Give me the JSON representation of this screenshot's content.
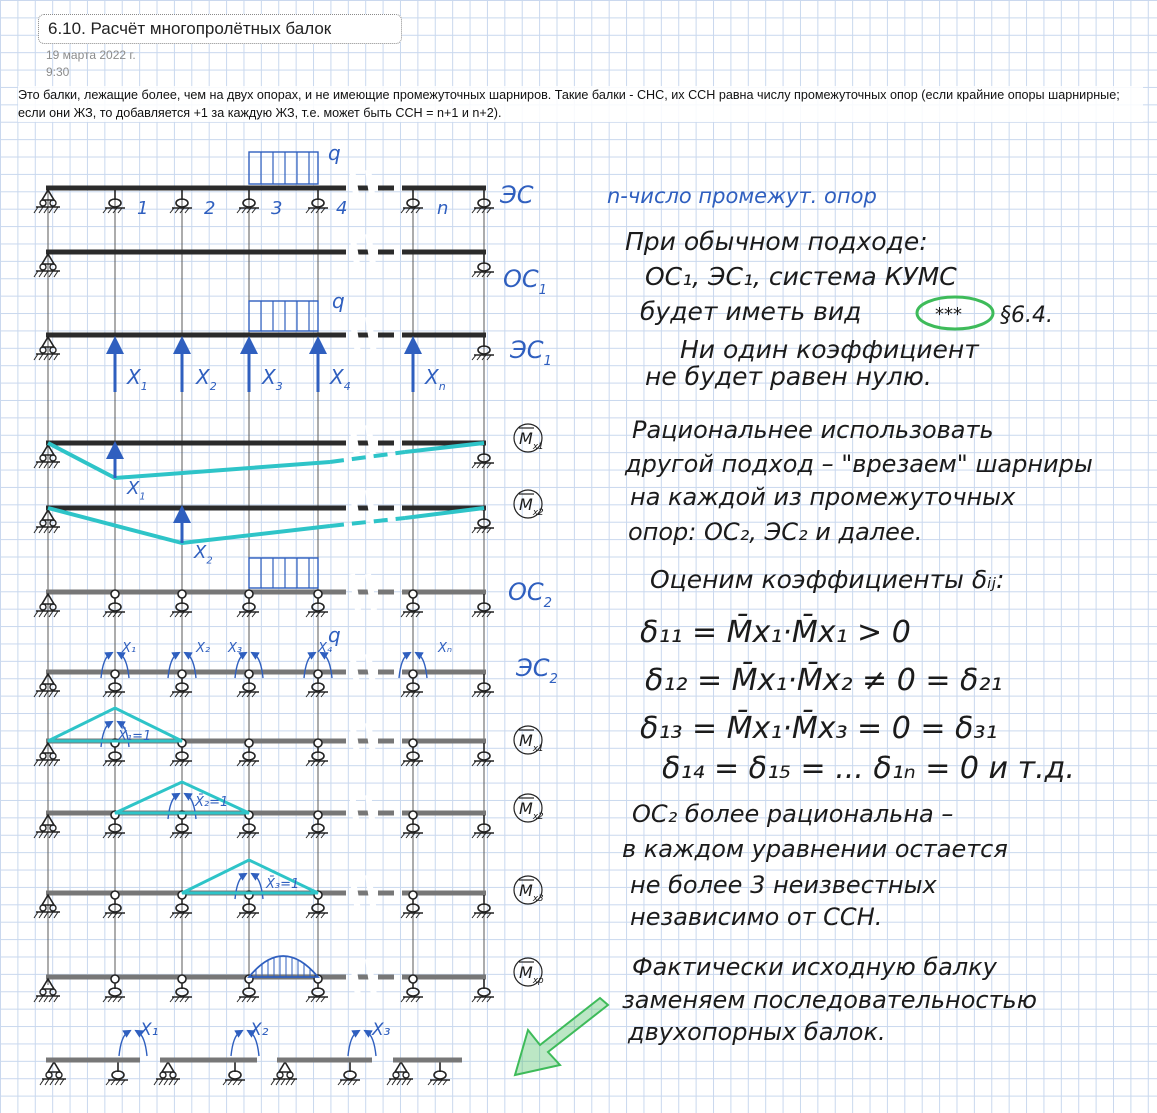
{
  "title": "6.10. Расчёт многопролётных балок",
  "date": "19 марта 2022 г.",
  "time": "9:30",
  "intro": "Это балки, лежащие более, чем на двух опорах, и не имеющие промежуточных шарниров. Такие балки - СНС, их ССН равна числу промежуточных опор (если крайние опоры шарнирные; если они ЖЗ, то добавляется +1 за каждую ЖЗ, т.е. может быть ССН = n+1 и n+2).",
  "colors": {
    "ink": "#1b1b1b",
    "blue": "#2f5fbf",
    "teal": "#2ec4c8",
    "green": "#3ebb5a",
    "grid": "#c9d8ee"
  },
  "diagram": {
    "labels": {
      "es": "ЭС",
      "os1": "ОС",
      "os1_sub": "1",
      "es1": "ЭС",
      "es1_sub": "1",
      "os2": "ОС",
      "os2_sub": "2",
      "es2": "ЭС",
      "es2_sub": "2",
      "q": "q",
      "support_numbers": [
        "1",
        "2",
        "3",
        "4",
        "n"
      ],
      "x_labels": [
        "X",
        "X",
        "X",
        "X",
        "X"
      ],
      "x_subs": [
        "1",
        "2",
        "3",
        "4",
        "n"
      ],
      "m_x1": "M",
      "m_x1_sub": "x1",
      "m_x2": "M",
      "m_x2_sub": "x2",
      "m_x3": "M",
      "m_x3_sub": "x3",
      "m_xp": "M",
      "m_xp_sub": "xp",
      "unit1": "X̄₁=1",
      "unit2": "X̄₂=1",
      "unit3": "X̄₃=1",
      "x_small": [
        "X₁",
        "X₂",
        "X₃",
        "X₄",
        "Xₙ"
      ],
      "x_bottom": [
        "X₁",
        "X₂",
        "X₃"
      ]
    }
  },
  "notes": {
    "n_def": "n-число промежут. опор",
    "p1": [
      "При обычном подходе:",
      "ОС₁, ЭС₁, система КУМС",
      "будет иметь вид",
      "Ни один коэффициент",
      "не будет равен нулю."
    ],
    "p1_circle": "***",
    "p1_ref": "§6.4.",
    "p2": [
      "Рациональнее использовать",
      "другой подход – \"врезаем\" шарниры",
      "на каждой из промежуточных",
      "опор: ОС₂, ЭС₂ и далее."
    ],
    "p3": [
      "Оценим коэффициенты δᵢⱼ:"
    ],
    "formulas": [
      "δ₁₁ = M̄x₁·M̄x₁ > 0",
      "δ₁₂ = M̄x₁·M̄x₂ ≠ 0 = δ₂₁",
      "δ₁₃ = M̄x₁·M̄x₃ = 0 = δ₃₁",
      "δ₁₄ = δ₁₅ = ... δ₁ₙ = 0  и т.д."
    ],
    "p4": [
      "ОС₂ более рациональна –",
      "в каждом уравнении остается",
      "не более 3 неизвестных",
      "независимо от ССН."
    ],
    "p5": [
      "Фактически исходную балку",
      "заменяем последовательностью",
      "двухопорных балок."
    ]
  }
}
